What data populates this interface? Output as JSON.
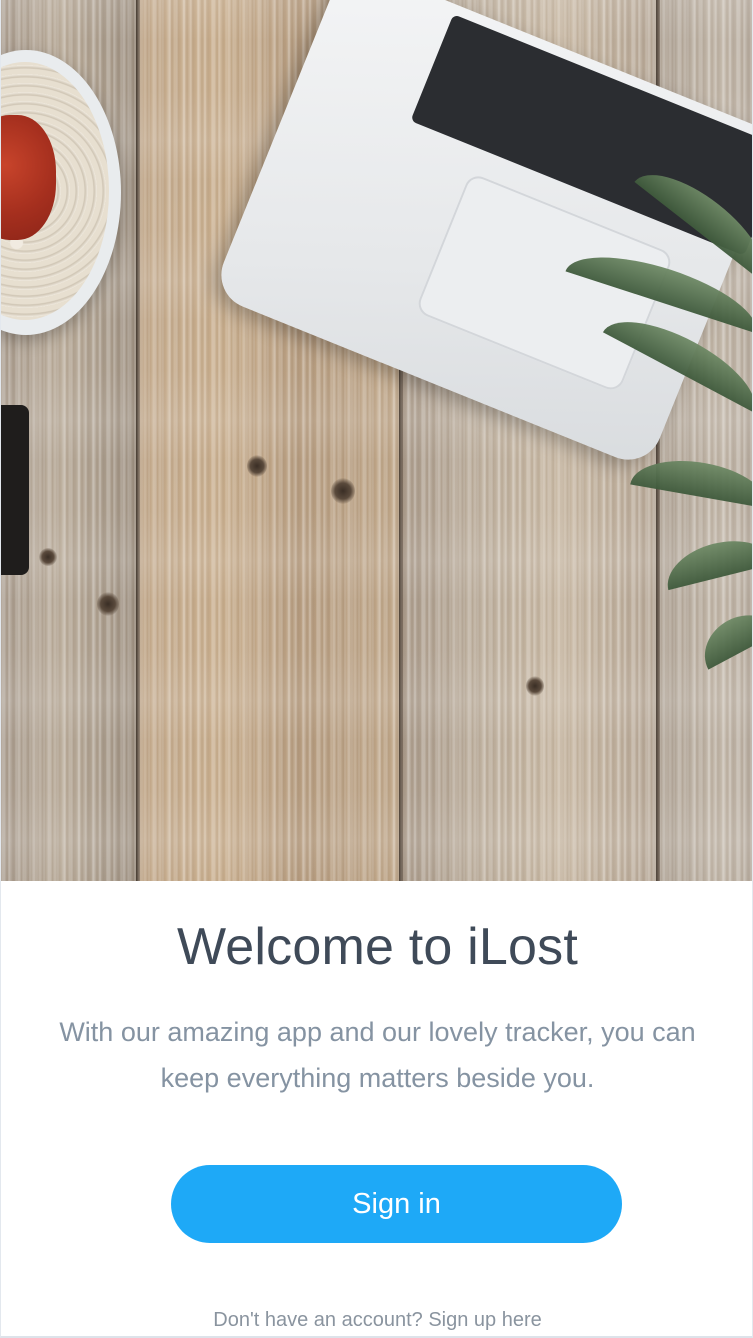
{
  "hero": {
    "image": "wooden-desk-photo"
  },
  "welcome": {
    "title": "Welcome to iLost",
    "description": "With our amazing app and our lovely tracker, you can keep everything matters beside you."
  },
  "actions": {
    "signin_label": "Sign in",
    "signup_link": "Don't have an account? Sign up here"
  },
  "colors": {
    "accent": "#1ea9f7",
    "title": "#3f4a58",
    "body_text": "#8593a2"
  }
}
